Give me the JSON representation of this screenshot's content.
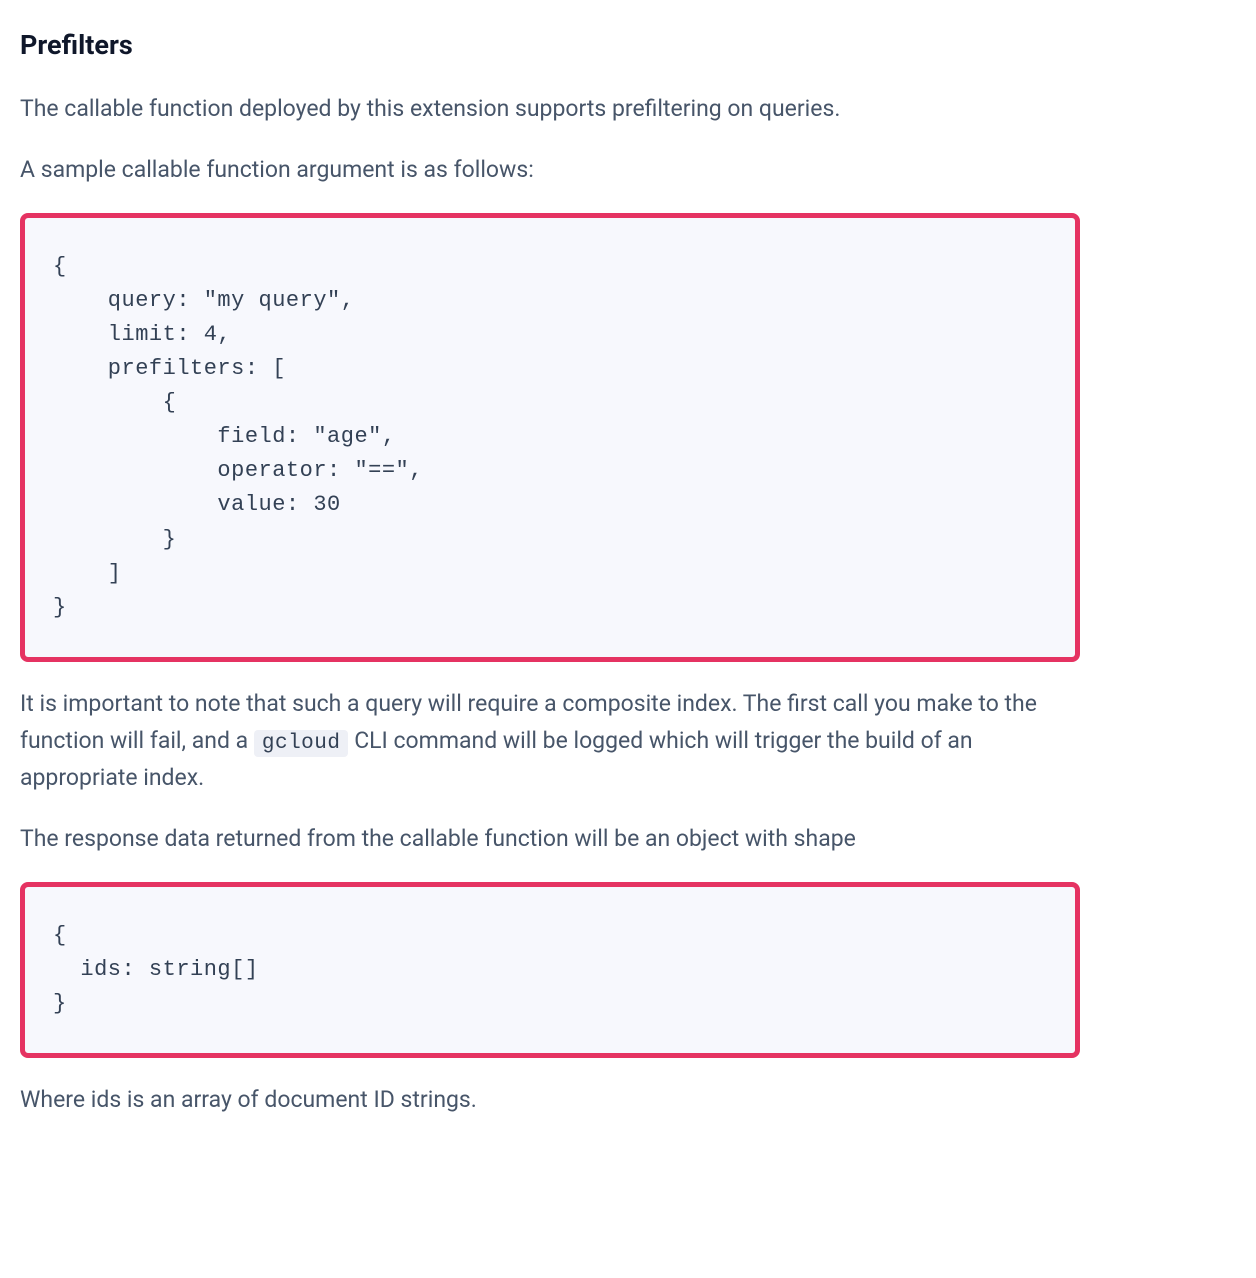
{
  "heading": "Prefilters",
  "intro_p1": "The callable function deployed by this extension supports prefiltering on queries.",
  "intro_p2": "A sample callable function argument is as follows:",
  "code_block_1": "{\n    query: \"my query\",\n    limit: 4,\n    prefilters: [\n        {\n            field: \"age\",\n            operator: \"==\",\n            value: 30\n        }\n    ]\n}",
  "note_part1": "It is important to note that such a query will require a composite index. The first call you make to the function will fail, and a ",
  "note_code": "gcloud",
  "note_part2": " CLI command will be logged which will trigger the build of an appropriate index.",
  "response_intro": "The response data returned from the callable function will be an object with shape",
  "code_block_2": "{\n  ids: string[]\n}",
  "closing_p": "Where ids is an array of document ID strings."
}
